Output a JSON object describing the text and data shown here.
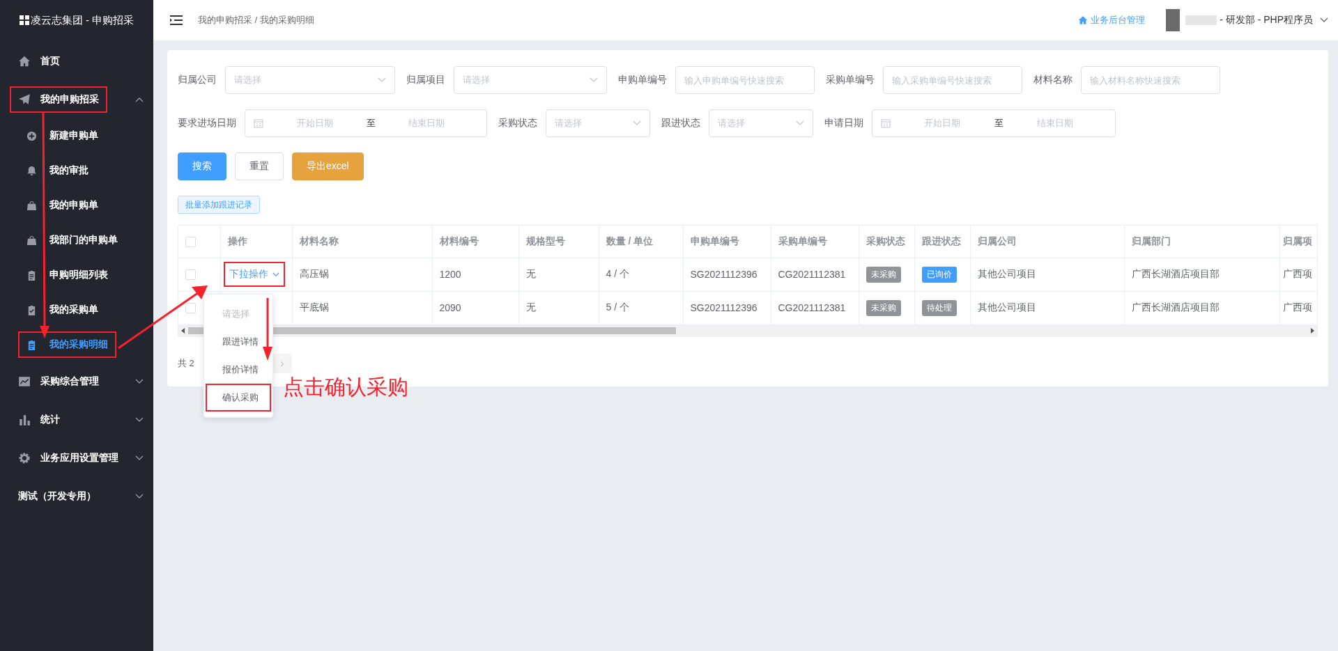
{
  "sidebar": {
    "title": "凌云志集团 - 申购招采",
    "items": [
      {
        "label": "首页",
        "highlighted": false
      },
      {
        "label": "我的申购招采",
        "expanded": true,
        "highlighted": true,
        "children": [
          {
            "label": "新建申购单",
            "selected": false,
            "highlighted": false
          },
          {
            "label": "我的审批",
            "selected": false,
            "highlighted": false
          },
          {
            "label": "我的申购单",
            "selected": false,
            "highlighted": false
          },
          {
            "label": "我部门的申购单",
            "selected": false,
            "highlighted": false
          },
          {
            "label": "申购明细列表",
            "selected": false,
            "highlighted": false
          },
          {
            "label": "我的采购单",
            "selected": false,
            "highlighted": false
          },
          {
            "label": "我的采购明细",
            "selected": true,
            "highlighted": true
          }
        ]
      },
      {
        "label": "采购综合管理",
        "expanded": false,
        "highlighted": false
      },
      {
        "label": "统计",
        "expanded": false,
        "highlighted": false
      },
      {
        "label": "业务应用设置管理",
        "expanded": false,
        "highlighted": false
      },
      {
        "label": "测试（开发专用）",
        "expanded": false,
        "highlighted": false
      }
    ]
  },
  "header": {
    "breadcrumb": "我的申购招采 / 我的采购明细",
    "admin_link": "业务后台管理",
    "user": "- 研发部 - PHP程序员"
  },
  "filters": [
    [
      {
        "kind": "select",
        "label": "归属公司",
        "placeholder": "请选择"
      },
      {
        "kind": "select",
        "label": "归属项目",
        "placeholder": "请选择"
      },
      {
        "kind": "input",
        "label": "申购单编号",
        "placeholder": "输入申购单编号快速搜索"
      },
      {
        "kind": "input",
        "label": "采购单编号",
        "placeholder": "输入采购单编号快速搜索"
      },
      {
        "kind": "input",
        "label": "材料名称",
        "placeholder": "输入材料名称快速搜索"
      }
    ],
    [
      {
        "kind": "daterange",
        "label": "要求进场日期",
        "start_placeholder": "开始日期",
        "separator": "至",
        "end_placeholder": "结束日期"
      },
      {
        "kind": "select",
        "label": "采购状态",
        "placeholder": "请选择"
      },
      {
        "kind": "select",
        "label": "跟进状态",
        "placeholder": "请选择"
      },
      {
        "kind": "daterange",
        "label": "申请日期",
        "start_placeholder": "开始日期",
        "separator": "至",
        "end_placeholder": "结束日期"
      }
    ]
  ],
  "buttons": [
    {
      "kind": "primary",
      "label": "搜索"
    },
    {
      "kind": "default",
      "label": "重置"
    },
    {
      "kind": "warning",
      "label": "导出excel"
    }
  ],
  "batch_button": "批量添加跟进记录",
  "table": {
    "all_checked": false,
    "columns": [
      "操作",
      "材料名称",
      "材料编号",
      "规格型号",
      "数量 / 单位",
      "申购单编号",
      "采购单编号",
      "采购状态",
      "跟进状态",
      "归属公司",
      "归属部门",
      "归属项"
    ],
    "rows": [
      {
        "checked": false,
        "action": {
          "label": "下拉操作",
          "highlighted": true
        },
        "material": "高压锅",
        "code": "1200",
        "spec": "无",
        "qty": "4 / 个",
        "req_no": "SG2021112396",
        "po_no": "CG2021112381",
        "po_status": {
          "text": "未采购",
          "color": "#909399"
        },
        "follow_status": {
          "text": "已询价",
          "color": "#409eff"
        },
        "company": "其他公司项目",
        "dept": "广西长湖酒店项目部",
        "project": "广西项"
      },
      {
        "checked": false,
        "material": "平底锅",
        "code": "2090",
        "spec": "无",
        "qty": "5 / 个",
        "req_no": "SG2021112396",
        "po_no": "CG2021112381",
        "po_status": {
          "text": "未采购",
          "color": "#909399"
        },
        "follow_status": {
          "text": "待处理",
          "color": "#909399"
        },
        "company": "其他公司项目",
        "dept": "广西长湖酒店项目部",
        "project": "广西项"
      }
    ]
  },
  "pagination": {
    "total": "共 2",
    "next": "›"
  },
  "dropdown": {
    "items": [
      {
        "label": "请选择",
        "disabled": true,
        "highlighted": false
      },
      {
        "label": "跟进详情",
        "disabled": false,
        "highlighted": false
      },
      {
        "label": "报价详情",
        "disabled": false,
        "highlighted": false
      },
      {
        "label": "确认采购",
        "disabled": false,
        "highlighted": true
      }
    ]
  },
  "annotation": "点击确认采购"
}
